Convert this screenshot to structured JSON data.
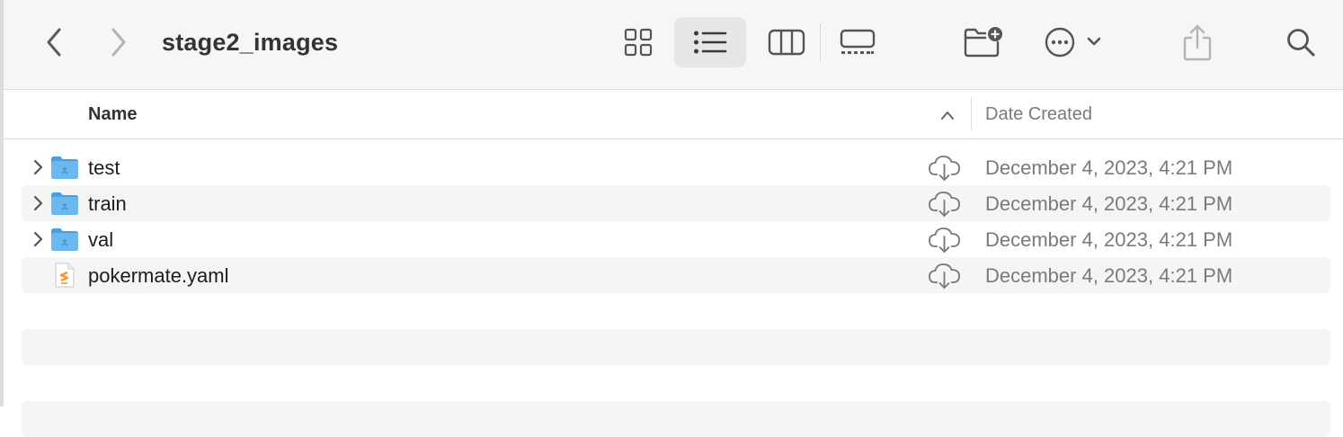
{
  "window": {
    "title": "stage2_images"
  },
  "toolbar": {
    "back_icon": "chevron-left-icon",
    "forward_icon": "chevron-right-icon",
    "views": [
      "icon-view",
      "list-view",
      "column-view",
      "gallery-view"
    ],
    "selected_view": "list-view",
    "new_folder_icon": "folder-badge-plus-icon",
    "more_icon": "ellipsis-circle-icon",
    "share_icon": "share-icon",
    "search_icon": "search-icon"
  },
  "columns": {
    "name": "Name",
    "date_created": "Date Created",
    "sort": "ascending"
  },
  "files": [
    {
      "name": "test",
      "kind": "folder",
      "date": "December 4, 2023, 4:21 PM"
    },
    {
      "name": "train",
      "kind": "folder",
      "date": "December 4, 2023, 4:21 PM"
    },
    {
      "name": "val",
      "kind": "folder",
      "date": "December 4, 2023, 4:21 PM"
    },
    {
      "name": "pokermate.yaml",
      "kind": "yaml-file",
      "date": "December 4, 2023, 4:21 PM"
    }
  ],
  "colors": {
    "folder": "#6bb8ef",
    "folder_dark": "#4a9fdf",
    "yaml_accent": "#f29a2e",
    "alt_row": "#f4f5f5"
  }
}
